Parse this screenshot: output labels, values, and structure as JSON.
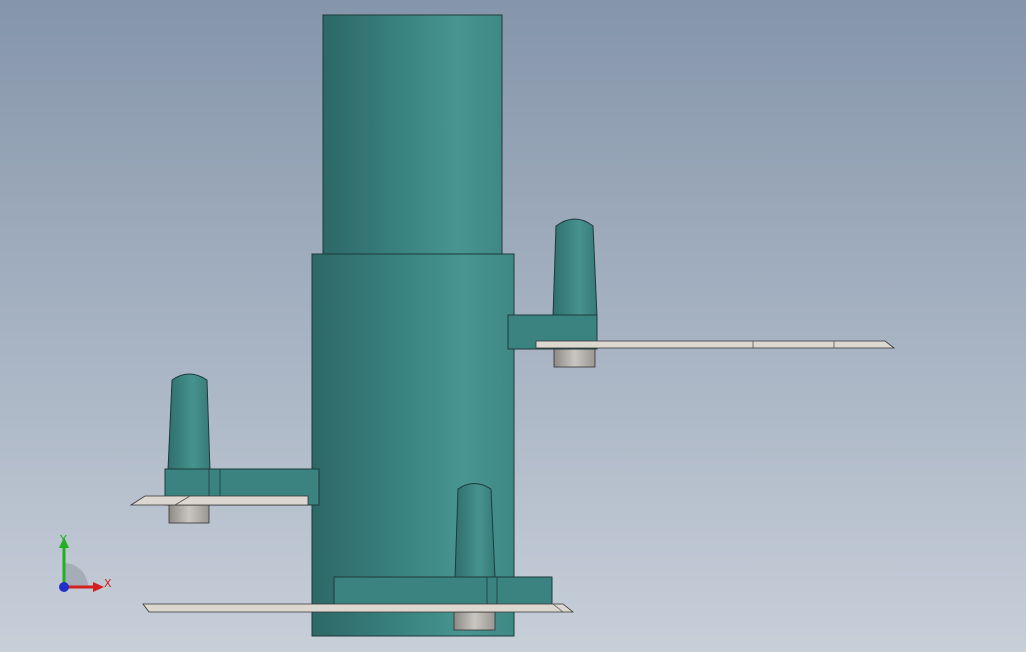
{
  "viewport": {
    "background_top": "#8595aa",
    "background_bottom": "#c7cfd9"
  },
  "model": {
    "body_color": "#3f8a88",
    "body_highlight": "#4a9896",
    "body_shadow": "#2f6b6a",
    "blade_color": "#d9d4cc",
    "pin_color": "#a9a6a0"
  },
  "triad": {
    "x_label": "X",
    "y_label": "Y",
    "x_color": "#d42020",
    "y_color": "#20b020",
    "z_color": "#2030c8"
  }
}
